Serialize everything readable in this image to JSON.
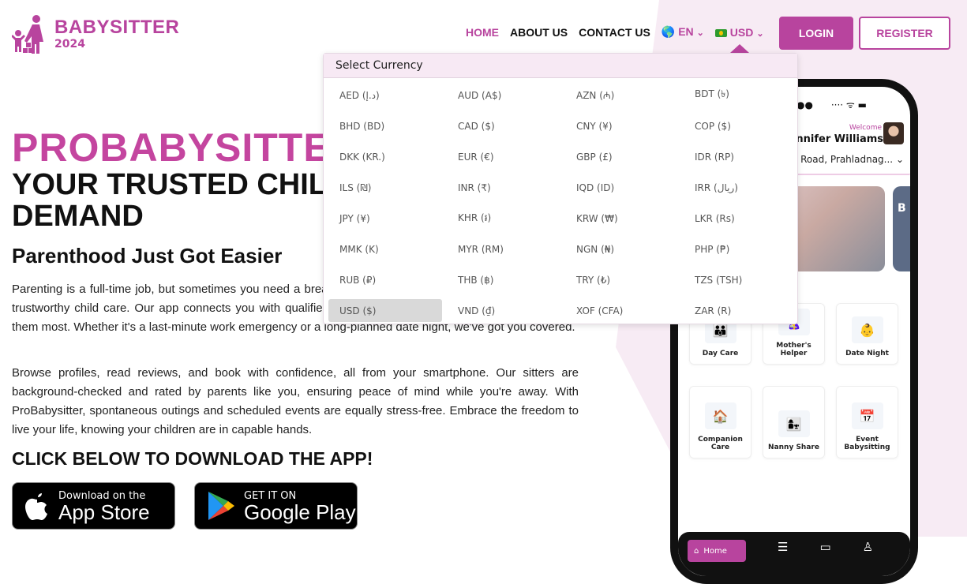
{
  "brand": {
    "name": "BABYSITTER",
    "year": "2024",
    "color": "#b8449e"
  },
  "nav": {
    "items": [
      "HOME",
      "ABOUT US",
      "CONTACT US"
    ],
    "language": "EN",
    "currency": "USD",
    "login": "LOGIN",
    "register": "REGISTER"
  },
  "currency_dropdown": {
    "title": "Select Currency",
    "selected": "USD ($)",
    "options": [
      "AED (د.إ)",
      "AUD (A$)",
      "AZN (₼)",
      "BDT (৳)",
      "BHD (BD)",
      "CAD ($)",
      "CNY (¥)",
      "COP ($)",
      "DKK (KR.)",
      "EUR (€)",
      "GBP (£)",
      "IDR (RP)",
      "ILS (₪)",
      "INR (₹)",
      "IQD (ID)",
      "IRR (ریال)",
      "JPY (¥)",
      "KHR (៛)",
      "KRW (₩)",
      "LKR (Rs)",
      "MMK (K)",
      "MYR (RM)",
      "NGN (₦)",
      "PHP (₱)",
      "RUB (₽)",
      "THB (฿)",
      "TRY (₺)",
      "TZS (TSH)",
      "USD ($)",
      "VND (₫)",
      "XOF (CFA)",
      "ZAR (R)"
    ]
  },
  "hero": {
    "title": "PROBABYSITTER",
    "subtitle": "YOUR TRUSTED CHILD CARE ON DEMAND",
    "heading": "Parenthood Just Got Easier",
    "para1": "Parenting is a full-time job, but sometimes you need a break. ProBabysitter is your on-demand solution for trustworthy child care. Our app connects you with qualified babysitters who are available when you need them most. Whether it's a last-minute work emergency or a long-planned date night, we've got you covered.",
    "para2": "Browse profiles, read reviews, and book with confidence, all from your smartphone. Our sitters are background-checked and rated by parents like you, ensuring peace of mind while you're away. With ProBabysitter, spontaneous outings and scheduled events are equally stress-free. Embrace the freedom to live your life, knowing your children are in capable hands.",
    "cta": "CLICK BELOW TO DOWNLOAD THE APP!"
  },
  "stores": {
    "apple_small": "Download on the",
    "apple_big": "App Store",
    "google_small": "GET IT ON",
    "google_big": "Google Play"
  },
  "phone": {
    "welcome": "Welcome",
    "name": "Jennifer Williams",
    "address": "Road, Prahladnag...",
    "banner2_text": "B S",
    "services": [
      "Day Care",
      "Mother's Helper",
      "Date Night",
      "Companion Care",
      "Nanny Share",
      "Event Babysitting"
    ],
    "nav_home": "Home"
  }
}
